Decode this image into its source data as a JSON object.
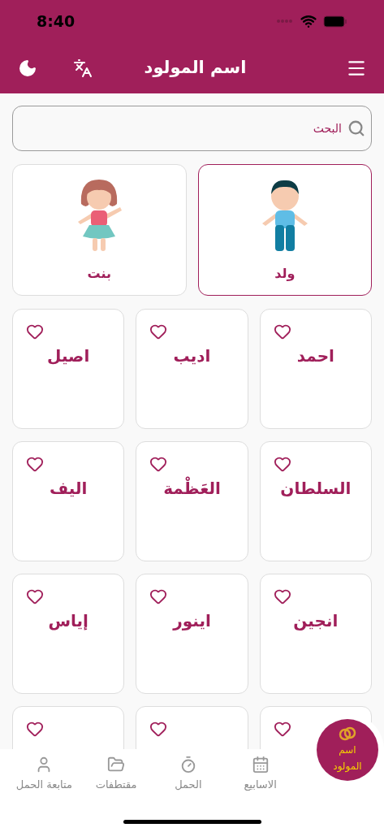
{
  "status_bar": {
    "time": "8:40"
  },
  "header": {
    "title": "اسم المولود"
  },
  "search": {
    "placeholder": "البحث"
  },
  "genders": [
    {
      "label": "ولد",
      "selected": true
    },
    {
      "label": "بنت",
      "selected": false
    }
  ],
  "names": [
    {
      "name": "احمد",
      "favorite": false
    },
    {
      "name": "اديب",
      "favorite": false
    },
    {
      "name": "اصيل",
      "favorite": false
    },
    {
      "name": "السلطان",
      "favorite": false
    },
    {
      "name": "العَظْمة",
      "favorite": false
    },
    {
      "name": "اليف",
      "favorite": false
    },
    {
      "name": "انجين",
      "favorite": false
    },
    {
      "name": "اينور",
      "favorite": false
    },
    {
      "name": "إياس",
      "favorite": false
    },
    {
      "favorite": false
    },
    {
      "favorite": false
    },
    {
      "favorite": false
    }
  ],
  "nav": [
    {
      "label": "اسم المولود",
      "selected": true
    },
    {
      "label": "الاسابيع",
      "selected": false
    },
    {
      "label": "الحمل",
      "selected": false
    },
    {
      "label": "مقتطفات",
      "selected": false
    },
    {
      "label": "متابعة الحمل",
      "selected": false
    }
  ]
}
